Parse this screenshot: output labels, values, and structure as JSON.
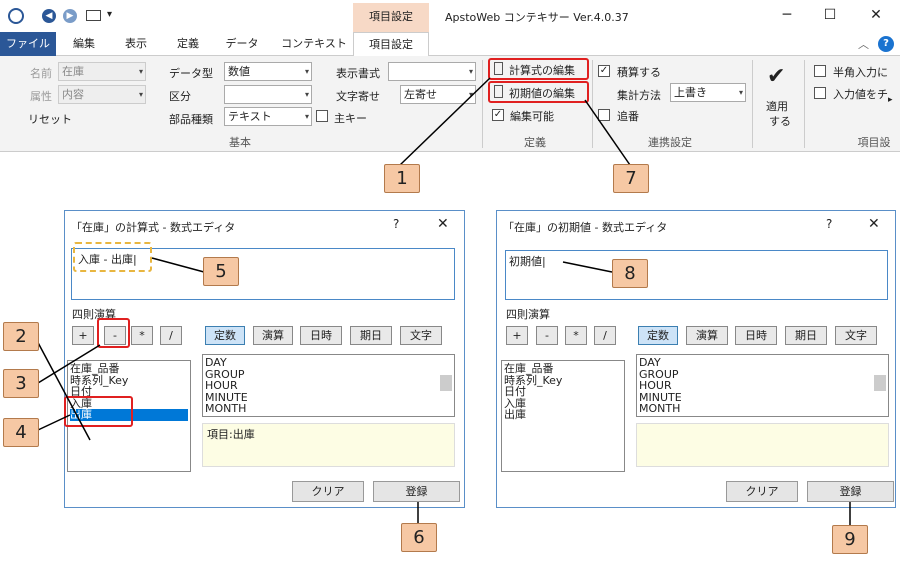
{
  "app": {
    "title": "ApstoWeb コンテキサー Ver.4.0.37",
    "context_tab": "項目設定",
    "min": "─",
    "max": "☐",
    "close": "✕"
  },
  "tabs": [
    "ファイル",
    "編集",
    "表示",
    "定義",
    "データ",
    "コンテキスト",
    "項目設定"
  ],
  "ribbon": {
    "name_label": "名前",
    "name_value": "在庫",
    "attr_label": "属性",
    "attr_value": "内容",
    "reset": "リセット",
    "dtype_label": "データ型",
    "dtype_value": "数値",
    "div_label": "区分",
    "div_value": "",
    "parts_label": "部品種類",
    "parts_value": "テキスト",
    "fmt_label": "表示書式",
    "fmt_value": "",
    "align_label": "文字寄せ",
    "align_value": "左寄せ",
    "mainkey": "主キー",
    "group_basic": "基本",
    "calc_edit": "計算式の編集",
    "init_edit": "初期値の編集",
    "editable": "編集可能",
    "group_def": "定義",
    "accum": "積算する",
    "agg_label": "集計方法",
    "agg_value": "上書き",
    "append": "追番",
    "group_link": "連携設定",
    "apply": "適用\nする",
    "apply1": "適用",
    "apply2": "する",
    "half": "半角入力に",
    "input": "入力値をチ",
    "group_item": "項目設"
  },
  "dlg1": {
    "title": "「在庫」の計算式 - 数式エディタ",
    "help": "?",
    "close": "✕",
    "expr": "入庫 - 出庫|",
    "ops_label": "四則演算",
    "ops": [
      "+",
      "-",
      "*",
      "/"
    ],
    "cats": [
      "定数",
      "演算",
      "日時",
      "期日",
      "文字"
    ],
    "fields": [
      "在庫_品番",
      "時系列_Key",
      "日付",
      "入庫",
      "出庫"
    ],
    "funcs": [
      "DAY",
      "GROUP",
      "HOUR",
      "MINUTE",
      "MONTH"
    ],
    "desc": "項目:出庫",
    "clear": "クリア",
    "register": "登録"
  },
  "dlg2": {
    "title": "「在庫」の初期値 - 数式エディタ",
    "help": "?",
    "close": "✕",
    "expr": "初期値|",
    "ops_label": "四則演算",
    "ops": [
      "+",
      "-",
      "*",
      "/"
    ],
    "cats": [
      "定数",
      "演算",
      "日時",
      "期日",
      "文字"
    ],
    "fields": [
      "在庫_品番",
      "時系列_Key",
      "日付",
      "入庫",
      "出庫"
    ],
    "funcs": [
      "DAY",
      "GROUP",
      "HOUR",
      "MINUTE",
      "MONTH"
    ],
    "desc": "",
    "clear": "クリア",
    "register": "登録"
  },
  "callouts": [
    "1",
    "2",
    "3",
    "4",
    "5",
    "6",
    "7",
    "8",
    "9"
  ],
  "colors": {
    "accent": "#2b5797",
    "callout": "#f6c8a4",
    "highlight": "#e02020"
  }
}
